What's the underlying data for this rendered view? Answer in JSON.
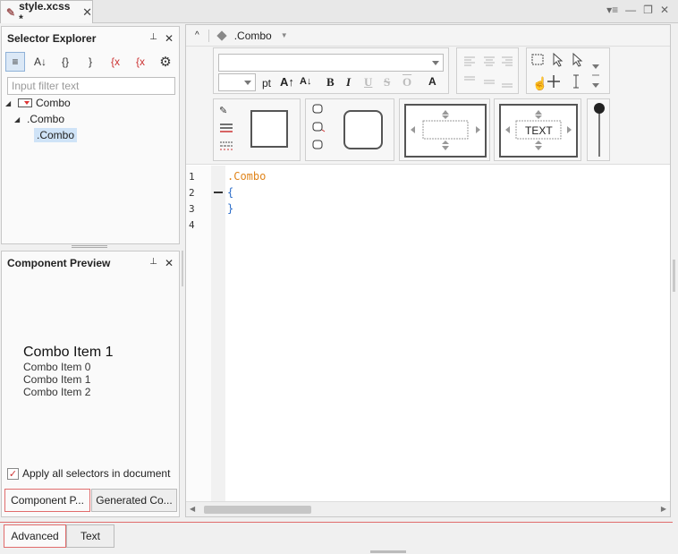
{
  "editor_tab": {
    "title": "style.xcss *",
    "close": "✕"
  },
  "window_controls": {
    "menu": "▾≡",
    "minimize": "—",
    "restore": "❐",
    "close": "✕"
  },
  "selector_explorer": {
    "title": "Selector Explorer",
    "pin": "📌",
    "close": "✕",
    "filter_placeholder": "Input filter text",
    "toolbar": [
      "≡",
      "A↓",
      "{}",
      "}",
      "{x",
      "{x",
      "⚙"
    ],
    "tree": [
      {
        "label": "Combo",
        "level": 0,
        "expanded": true
      },
      {
        "label": ".Combo",
        "level": 1,
        "expanded": true
      },
      {
        "label": ".Combo",
        "level": 2,
        "selected": true
      }
    ]
  },
  "component_preview": {
    "title": "Component Preview",
    "pin": "📌",
    "close": "✕",
    "selected_item": "Combo Item 1",
    "items": [
      "Combo Item 0",
      "Combo Item 1",
      "Combo Item 2"
    ],
    "apply_all_label": "Apply all selectors in document",
    "apply_all_checked": true,
    "tabs": [
      "Component P...",
      "Generated Co..."
    ]
  },
  "editor": {
    "breadcrumb_caret": "^",
    "breadcrumb": ".Combo",
    "font_size_unit": "pt",
    "format_buttons": [
      "A↑",
      "A↓",
      "B",
      "I",
      "U",
      "S",
      "O",
      "A"
    ],
    "text_box_label": "TEXT",
    "code": {
      "line_numbers": [
        "1",
        "2",
        "3",
        "4"
      ],
      "lines": [
        ".Combo",
        "{",
        "}",
        ""
      ]
    }
  },
  "page_tabs": [
    "Advanced",
    "Text"
  ],
  "colors": {
    "accent": "#e06c6c",
    "selector_color": "#e0841a",
    "brace_color": "#2a6cc9"
  }
}
